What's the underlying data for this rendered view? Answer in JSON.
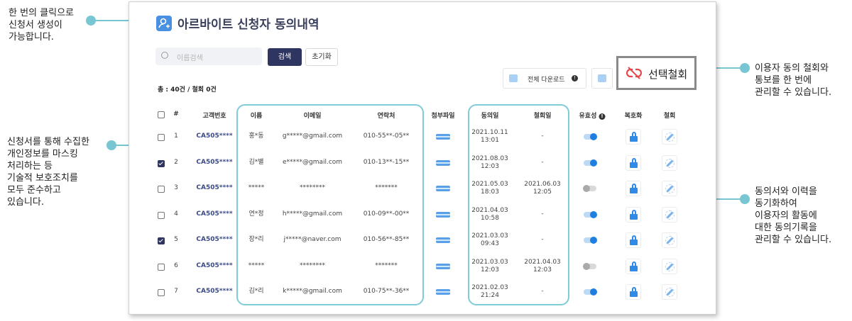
{
  "callouts": {
    "one_click": "한 번의 클릭으로\n신청서 생성이\n가능합니다.",
    "masking": "신청서를 통해 수집한\n개인정보를 마스킹\n처리하는 등\n기술적 보호조치를\n모두 준수하고\n있습니다.",
    "withdraw": "이용자 동의 철회와\n통보를 한 번에\n관리할 수 있습니다.",
    "sync": "동의서와 이력을\n동기화하여\n이용자의 활동에\n대한 동의기록을\n관리할 수 있습니다."
  },
  "page": {
    "title": "아르바이트 신청자 동의내역"
  },
  "search": {
    "placeholder": "이름검색",
    "search_label": "검색",
    "reset_label": "초기화"
  },
  "toolbar": {
    "download_all_label": "전체 다운로드",
    "info": "!",
    "withdraw_label": "선택철회"
  },
  "summary": "총 : 40건 / 철회 0건",
  "table": {
    "headers": {
      "index": "#",
      "customer_id": "고객번호",
      "name": "이름",
      "email": "이메일",
      "phone": "연락처",
      "attachment": "첨부파일",
      "consent_date": "동의일",
      "withdraw_date": "철회일",
      "validity": "유효성",
      "validity_info": "!",
      "restore": "복호화",
      "withdraw": "철회"
    },
    "rows": [
      {
        "checked": false,
        "index": "1",
        "customer_id": "CA505****",
        "name": "홍*동",
        "email": "g*****@gmail.com",
        "phone": "010-55**-05**",
        "consent_date": "2021.10.11",
        "consent_time": "13:01",
        "withdraw_date": "-",
        "withdraw_time": "",
        "valid": true
      },
      {
        "checked": true,
        "index": "2",
        "customer_id": "CA505****",
        "name": "김*별",
        "email": "e*****@gmail.com",
        "phone": "010-13**-15**",
        "consent_date": "2021.08.03",
        "consent_time": "12:03",
        "withdraw_date": "-",
        "withdraw_time": "",
        "valid": true
      },
      {
        "checked": false,
        "index": "3",
        "customer_id": "CA505****",
        "name": "*****",
        "email": "********",
        "phone": "*******",
        "consent_date": "2021.05.03",
        "consent_time": "18:03",
        "withdraw_date": "2021.06.03",
        "withdraw_time": "12:05",
        "valid": false
      },
      {
        "checked": false,
        "index": "4",
        "customer_id": "CA505****",
        "name": "연*정",
        "email": "h*****@gmail.com",
        "phone": "010-09**-00**",
        "consent_date": "2021.04.03",
        "consent_time": "10:58",
        "withdraw_date": "-",
        "withdraw_time": "",
        "valid": true
      },
      {
        "checked": true,
        "index": "5",
        "customer_id": "CA505****",
        "name": "장*리",
        "email": "j*****@naver.com",
        "phone": "010-56**-85**",
        "consent_date": "2021.03.03",
        "consent_time": "09:43",
        "withdraw_date": "-",
        "withdraw_time": "",
        "valid": true
      },
      {
        "checked": false,
        "index": "6",
        "customer_id": "CA505****",
        "name": "*****",
        "email": "********",
        "phone": "*******",
        "consent_date": "2021.03.03",
        "consent_time": "12:03",
        "withdraw_date": "2021.04.03",
        "withdraw_time": "12:03",
        "valid": false
      },
      {
        "checked": false,
        "index": "7",
        "customer_id": "CA505****",
        "name": "김*리",
        "email": "k*****@gmail.com",
        "phone": "010-75**-36**",
        "consent_date": "2021.02.03",
        "consent_time": "21:24",
        "withdraw_date": "-",
        "withdraw_time": "",
        "valid": true
      }
    ]
  },
  "colors": {
    "accent": "#79c6d3",
    "navy": "#2f3561",
    "blue": "#1f7fe0"
  }
}
